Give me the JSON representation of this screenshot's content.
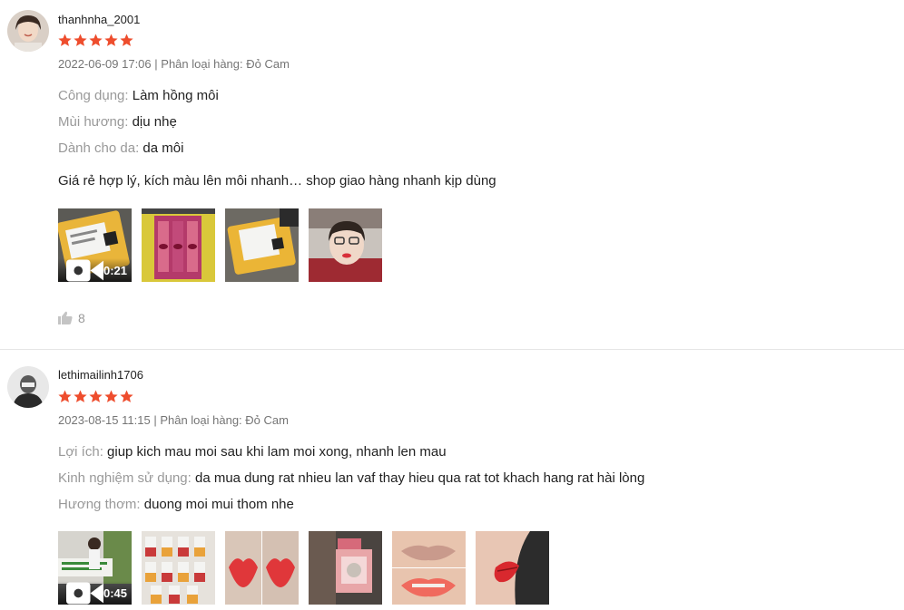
{
  "reviews": [
    {
      "username": "thanhnha_2001",
      "rating": 5,
      "date": "2022-06-09 17:06",
      "variation": "Phân loại hàng: Đỏ Cam",
      "attributes": [
        {
          "label": "Công dụng:",
          "value": "Làm hồng môi"
        },
        {
          "label": "Mùi hương:",
          "value": "dịu nhẹ"
        },
        {
          "label": "Dành cho da:",
          "value": "da môi"
        }
      ],
      "comment": "Giá rẻ hợp lý, kích màu lên môi nhanh… shop giao hàng nhanh kịp dùng",
      "video_duration": "0:21",
      "likes": "8"
    },
    {
      "username": "lethimailinh1706",
      "rating": 5,
      "date": "2023-08-15 11:15",
      "variation": "Phân loại hàng: Đỏ Cam",
      "attributes": [
        {
          "label": "Lợi ích:",
          "value": "giup kich mau moi sau khi lam moi xong, nhanh len mau"
        },
        {
          "label": "Kinh nghiệm sử dụng:",
          "value": "da mua dung rat nhieu lan vaf thay hieu qua rat tot khach hang rat hài lòng"
        },
        {
          "label": "Hương thơm:",
          "value": "duong moi mui thom nhe"
        }
      ],
      "video_duration": "0:45"
    }
  ],
  "colors": {
    "star": "#ee4d2d",
    "label": "#999999",
    "meta": "#757575"
  }
}
